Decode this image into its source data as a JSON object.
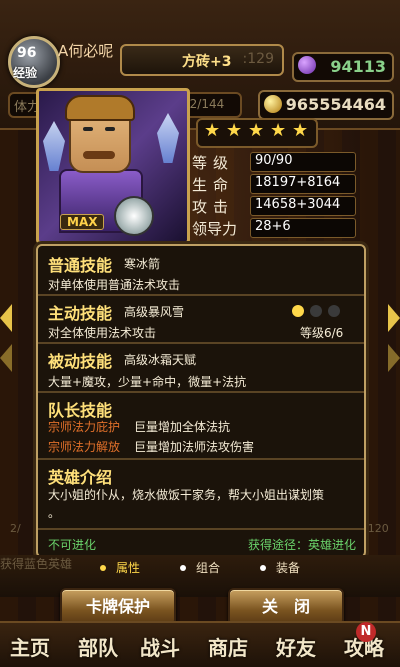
{
  "hud": {
    "player_name": "A何必呢",
    "level_badge": "96",
    "exp_label": "经验",
    "tile_banner": "方砖+3",
    "tile_ghost": ":129",
    "gems": "94113",
    "gold": "965554464",
    "stamina_label": "体力",
    "stamina_value": "62/144"
  },
  "hero": {
    "tag": "MAX",
    "stars": 5
  },
  "stats": [
    {
      "key": "等级",
      "value": "90/90"
    },
    {
      "key": "生命",
      "value": "18197+8164"
    },
    {
      "key": "攻击",
      "value": "14658+3044"
    },
    {
      "key": "领导力",
      "value": "28+6"
    }
  ],
  "panel": {
    "normal_skill_title": "普通技能",
    "normal_skill_name": "寒冰箭",
    "normal_skill_desc": "对单体使用普通法术攻击",
    "active_skill_title": "主动技能",
    "active_skill_name": "高级暴风雪",
    "active_skill_desc": "对全体使用法术攻击",
    "active_skill_level": "等级6/6",
    "passive_skill_title": "被动技能",
    "passive_skill_name": "高级冰霜天赋",
    "passive_skill_desc": "大量+魔攻，少量+命中，微量+法抗",
    "leader_skill_title": "队长技能",
    "leader_skill_1_label": "宗师法力庇护",
    "leader_skill_1_desc": "巨量增加全体法抗",
    "leader_skill_2_label": "宗师法力解放",
    "leader_skill_2_desc": "巨量增加法师法攻伤害",
    "intro_title": "英雄介绍",
    "intro_line1": "大小姐的仆从，烧水做饭干家务，帮大小姐出谋划策",
    "intro_line2": "。",
    "footer_left": "不可进化",
    "footer_right": "获得途径：英雄进化"
  },
  "dots": {
    "active": "#ffd84a",
    "inactive": "#3a3a3a"
  },
  "tabs": [
    "属性",
    "组合",
    "装备"
  ],
  "buttons": {
    "protect": "卡牌保护",
    "close": "关　闭"
  },
  "nav": [
    "主页",
    "部队",
    "战斗",
    "商店",
    "好友",
    "攻略"
  ],
  "nav_badge": "N",
  "ghost": {
    "left_label": "获得蓝色英雄",
    "left_count": "2/",
    "right_count": "/120"
  }
}
